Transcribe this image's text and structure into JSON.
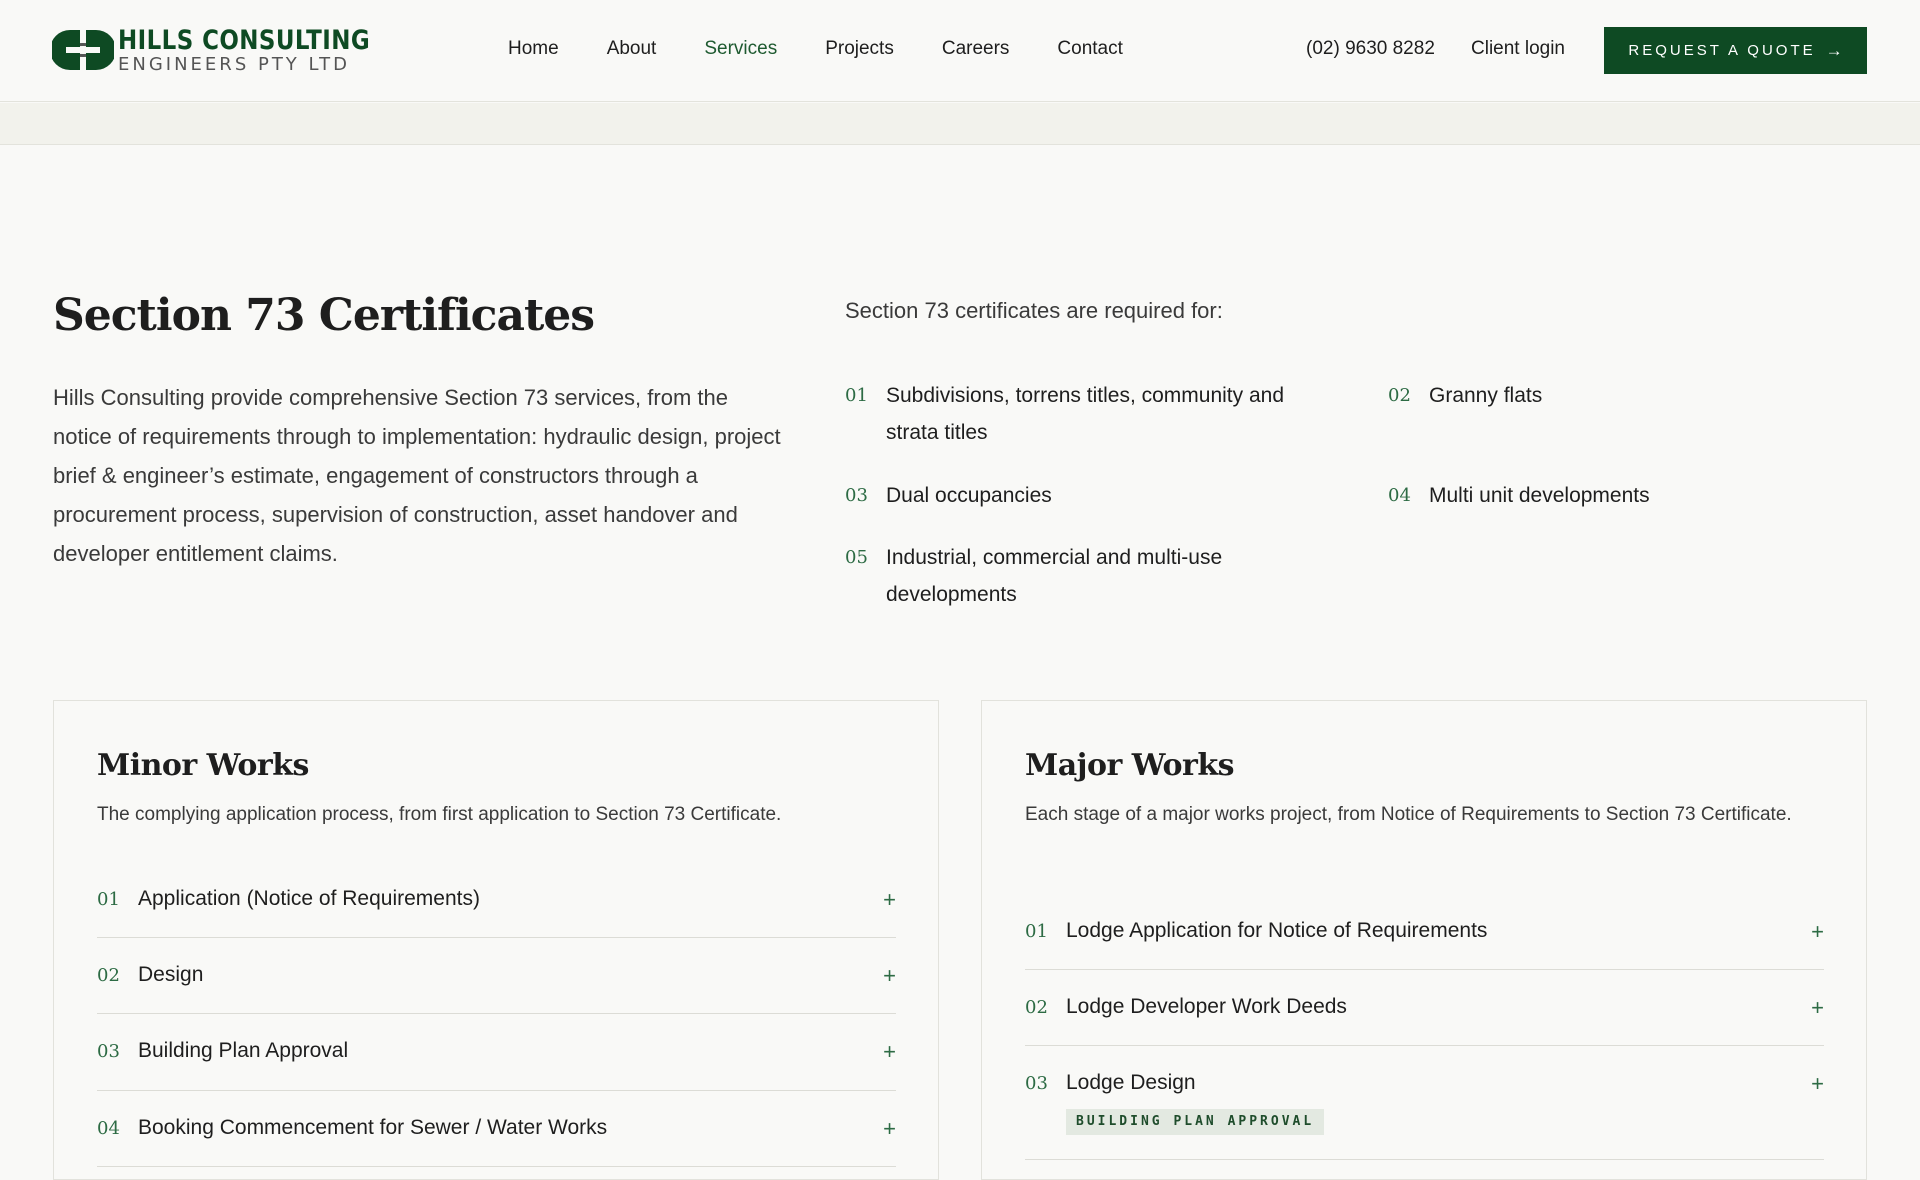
{
  "header": {
    "logo": {
      "name": "HILLS CONSULTING",
      "sub": "ENGINEERS PTY LTD"
    },
    "nav": [
      {
        "label": "Home",
        "active": false
      },
      {
        "label": "About",
        "active": false
      },
      {
        "label": "Services",
        "active": true
      },
      {
        "label": "Projects",
        "active": false
      },
      {
        "label": "Careers",
        "active": false
      },
      {
        "label": "Contact",
        "active": false
      }
    ],
    "phone": "(02) 9630 8282",
    "client_login": "Client login",
    "cta": {
      "label": "REQUEST A QUOTE",
      "arrow": "→"
    }
  },
  "intro": {
    "title": "Section 73 Certificates",
    "body": "Hills Consulting provide comprehensive Section 73 services, from the notice of requirements through to implementation: hydraulic design, project brief & engineer’s estimate, engagement of constructors through a procurement process, supervision of construction, asset handover and developer entitlement claims."
  },
  "requirements": {
    "heading": "Section 73 certificates are required for:",
    "items": [
      {
        "num": "01",
        "text": "Subdivisions, torrens titles, community and strata titles"
      },
      {
        "num": "02",
        "text": "Granny flats"
      },
      {
        "num": "03",
        "text": "Dual occupancies"
      },
      {
        "num": "04",
        "text": "Multi unit developments"
      },
      {
        "num": "05",
        "text": "Industrial, commercial and multi-use developments"
      }
    ]
  },
  "minor": {
    "title": "Minor Works",
    "desc": "The complying application process, from first application to Section 73 Certificate.",
    "steps": [
      {
        "num": "01",
        "label": "Application (Notice of Requirements)",
        "plus": "+"
      },
      {
        "num": "02",
        "label": "Design",
        "plus": "+"
      },
      {
        "num": "03",
        "label": "Building Plan Approval",
        "plus": "+"
      },
      {
        "num": "04",
        "label": "Booking Commencement for Sewer / Water Works",
        "plus": "+"
      }
    ]
  },
  "major": {
    "title": "Major Works",
    "desc": "Each stage of a major works project, from Notice of Requirements to Section 73 Certificate.",
    "steps": [
      {
        "num": "01",
        "label": "Lodge Application for Notice of Requirements",
        "plus": "+"
      },
      {
        "num": "02",
        "label": "Lodge Developer Work Deeds",
        "plus": "+"
      },
      {
        "num": "03",
        "label": "Lodge Design",
        "plus": "+",
        "tag": "BUILDING PLAN APPROVAL"
      }
    ]
  },
  "colors": {
    "brand_green": "#0e4a23",
    "accent_green": "#2d6b44",
    "background": "#f9f9f7"
  }
}
